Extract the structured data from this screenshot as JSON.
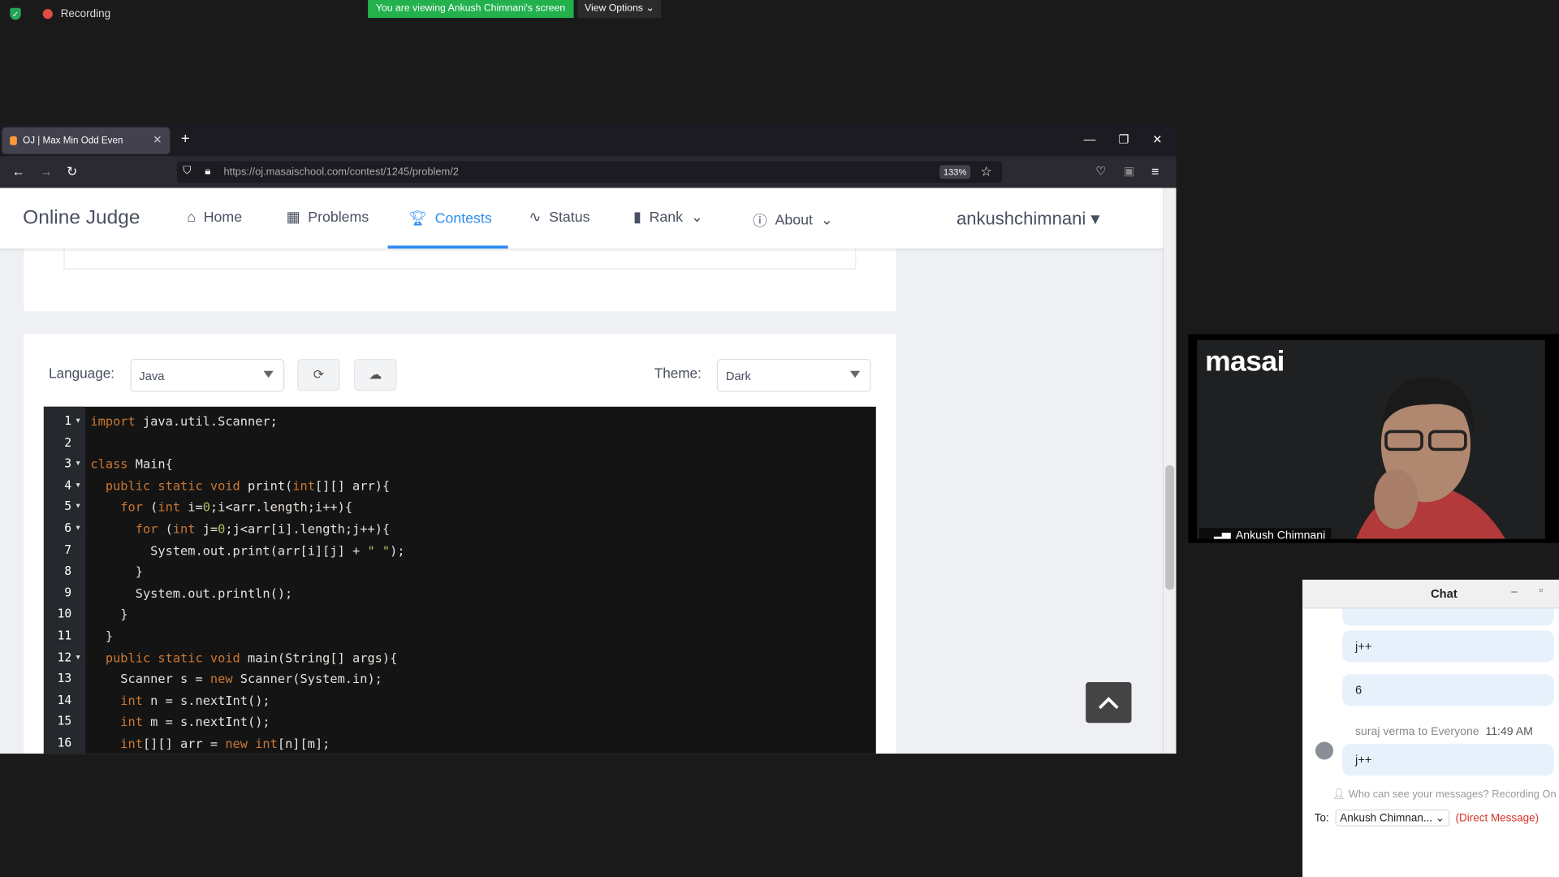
{
  "zoom_top": {
    "recording": "Recording",
    "viewing_banner": "You are viewing Ankush Chimnani's screen",
    "view_options": "View Options"
  },
  "browser": {
    "tab_title": "OJ | Max Min Odd Even",
    "url": "https://oj.masaischool.com/contest/1245/problem/2",
    "zoom": "133%"
  },
  "site": {
    "brand": "Online Judge",
    "menu": [
      {
        "icon": "home-icon",
        "label": "Home"
      },
      {
        "icon": "grid-icon",
        "label": "Problems"
      },
      {
        "icon": "trophy-icon",
        "label": "Contests"
      },
      {
        "icon": "pulse-icon",
        "label": "Status"
      },
      {
        "icon": "bar-chart-icon",
        "label": "Rank"
      },
      {
        "icon": "info-icon",
        "label": "About"
      }
    ],
    "user": "ankushchimnani",
    "active_color": "#2d8cf0"
  },
  "editor": {
    "language_label": "Language:",
    "language": "Java",
    "theme_label": "Theme:",
    "theme": "Dark",
    "lines": [
      "import java.util.Scanner;",
      "",
      "class Main{",
      "  public static void print(int[][] arr){",
      "    for (int i=0;i<arr.length;i++){",
      "      for (int j=0;j<arr[i].length;j++){",
      "        System.out.print(arr[i][j] + \" \");",
      "      }",
      "      System.out.println();",
      "    }",
      "  }",
      "  public static void main(String[] args){",
      "    Scanner s = new Scanner(System.in);",
      "    int n = s.nextInt();",
      "    int m = s.nextInt();",
      "    int[][] arr = new int[n][m];"
    ]
  },
  "video": {
    "logo": "masai",
    "name": "Ankush Chimnani"
  },
  "chat": {
    "title": "Chat",
    "messages": [
      "j++",
      "6",
      "j++"
    ],
    "sender": "suraj verma to Everyone",
    "time": "11:49 AM",
    "who_can_see": "Who can see your messages? Recording On",
    "to_label": "To:",
    "to_name": "Ankush Chimnan...",
    "dm": "(Direct Message)"
  }
}
